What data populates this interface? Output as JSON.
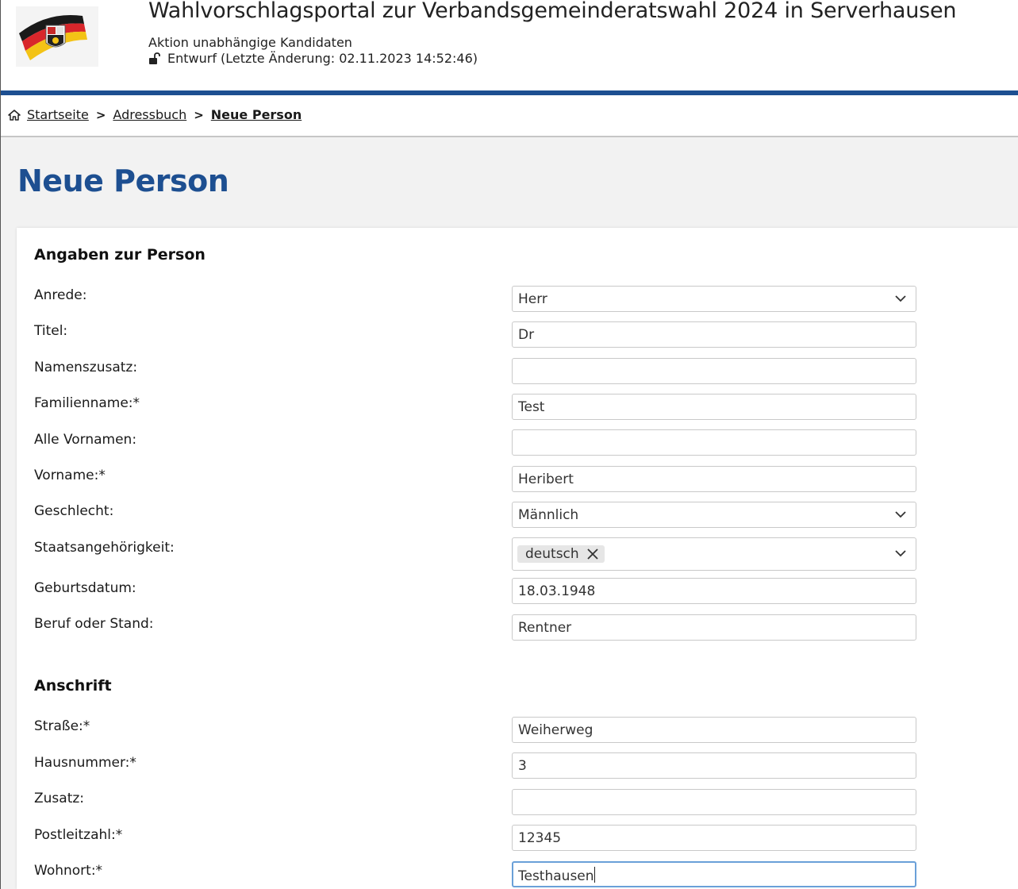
{
  "header": {
    "title": "Wahlvorschlagsportal zur Verbandsgemeinderatswahl 2024 in Serverhausen",
    "subtitle": "Aktion unabhängige Kandidaten",
    "status": "Entwurf (Letzte Änderung: 02.11.2023 14:52:46)"
  },
  "breadcrumb": {
    "home": "Startseite",
    "addressbook": "Adressbuch",
    "current": "Neue Person"
  },
  "page": {
    "title": "Neue Person"
  },
  "section_person": {
    "title": "Angaben zur Person",
    "anrede": {
      "label": "Anrede:",
      "value": "Herr"
    },
    "titel": {
      "label": "Titel:",
      "value": "Dr"
    },
    "namenszusatz": {
      "label": "Namenszusatz:",
      "value": ""
    },
    "familienname": {
      "label": "Familienname:*",
      "value": "Test"
    },
    "alle_vornamen": {
      "label": "Alle Vornamen:",
      "value": ""
    },
    "vorname": {
      "label": "Vorname:*",
      "value": "Heribert"
    },
    "geschlecht": {
      "label": "Geschlecht:",
      "value": "Männlich"
    },
    "staatsangehoerigkeit": {
      "label": "Staatsangehörigkeit:",
      "chip": "deutsch"
    },
    "geburtsdatum": {
      "label": "Geburtsdatum:",
      "value": "18.03.1948"
    },
    "beruf": {
      "label": "Beruf oder Stand:",
      "value": "Rentner"
    }
  },
  "section_address": {
    "title": "Anschrift",
    "strasse": {
      "label": "Straße:*",
      "value": "Weiherweg"
    },
    "hausnummer": {
      "label": "Hausnummer:*",
      "value": "3"
    },
    "zusatz": {
      "label": "Zusatz:",
      "value": ""
    },
    "plz": {
      "label": "Postleitzahl:*",
      "value": "12345"
    },
    "wohnort": {
      "label": "Wohnort:*",
      "value": "Testhausen"
    }
  },
  "colors": {
    "brand_blue": "#1d4f91",
    "focus_border": "#6aa0d8"
  },
  "icons": [
    "logo-emblem",
    "lock-open-icon",
    "home-icon",
    "chevron-down-icon",
    "close-icon"
  ]
}
